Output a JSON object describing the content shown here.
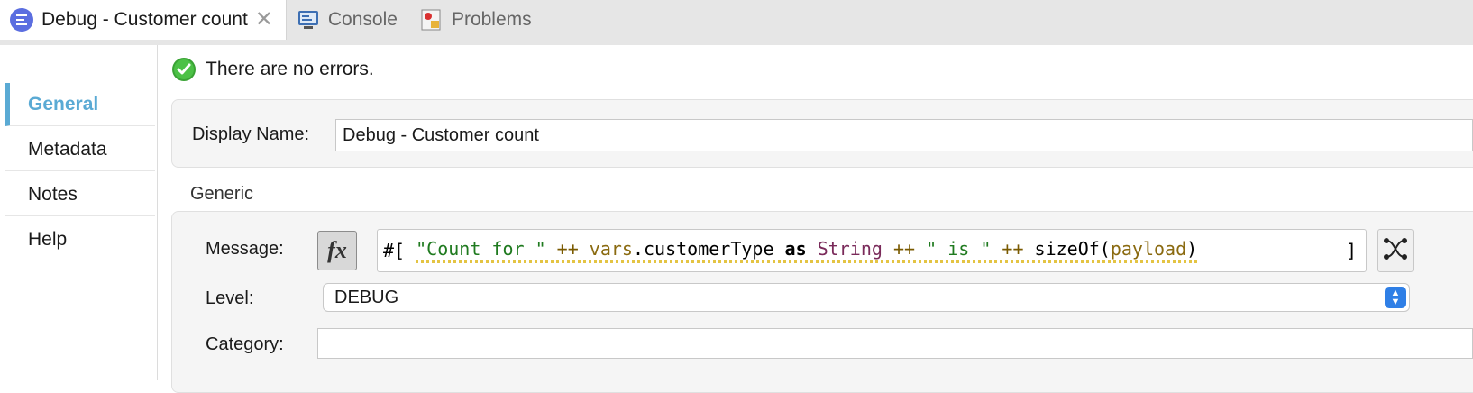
{
  "tabs": [
    {
      "label": "Debug - Customer count",
      "icon": "logger-icon",
      "active": true
    },
    {
      "label": "Console",
      "icon": "console-icon"
    },
    {
      "label": "Problems",
      "icon": "problems-icon"
    }
  ],
  "sidebar": {
    "items": [
      {
        "label": "General",
        "active": true
      },
      {
        "label": "Metadata"
      },
      {
        "label": "Notes"
      },
      {
        "label": "Help"
      }
    ]
  },
  "status": {
    "text": "There are no errors."
  },
  "form": {
    "display_name_label": "Display Name:",
    "display_name_value": "Debug - Customer count",
    "generic_title": "Generic",
    "message_label": "Message:",
    "fx_label": "fx",
    "expression": {
      "prefix": "#[ ",
      "part1": "\"Count for \"",
      "part2": " ++ ",
      "part3": "vars",
      "part4": ".customerType ",
      "part5": "as",
      "part6": " ",
      "part7": "String",
      "part8": " ++ ",
      "part9": "\" is \"",
      "part10": " ++ ",
      "part11": "sizeOf(",
      "part12": "payload",
      "part13": ")",
      "suffix": "]"
    },
    "level_label": "Level:",
    "level_value": "DEBUG",
    "category_label": "Category:",
    "category_value": ""
  },
  "colors": {
    "accent": "#5aaad4",
    "select_button": "#2f7fe6",
    "success": "#3aa335"
  }
}
